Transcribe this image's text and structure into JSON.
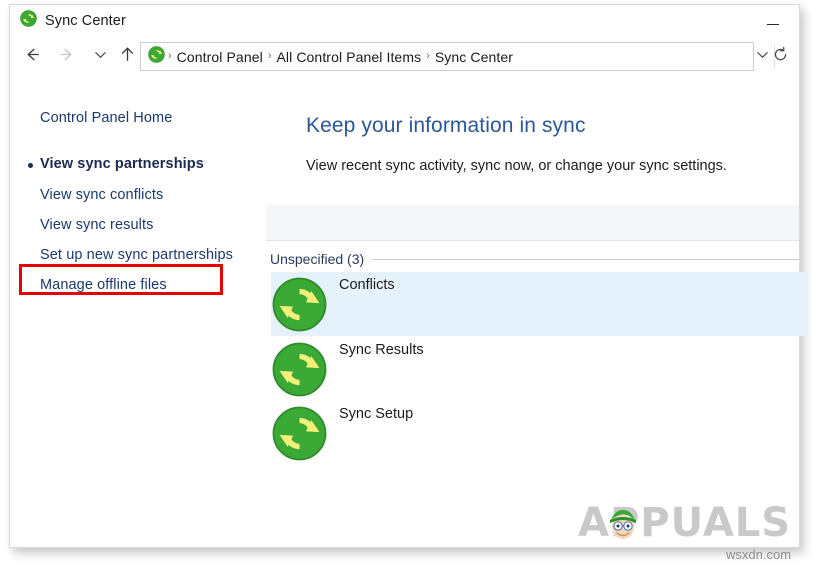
{
  "window": {
    "title": "Sync Center",
    "title_icon": "sync-icon",
    "minimize_label": "Minimize"
  },
  "nav": {
    "back_icon": "arrow-left-icon",
    "forward_icon": "arrow-right-icon",
    "recent_icon": "chevron-down-icon",
    "up_icon": "arrow-up-icon",
    "refresh_icon": "refresh-icon",
    "address_chevron_icon": "chevron-down-icon",
    "address_icon": "sync-icon",
    "breadcrumbs": [
      "Control Panel",
      "All Control Panel Items",
      "Sync Center"
    ],
    "separator": "›"
  },
  "sidebar": {
    "home_label": "Control Panel Home",
    "items": [
      {
        "label": "View sync partnerships",
        "current": true
      },
      {
        "label": "View sync conflicts",
        "current": false
      },
      {
        "label": "View sync results",
        "current": false
      },
      {
        "label": "Set up new sync partnerships",
        "current": false
      },
      {
        "label": "Manage offline files",
        "current": false,
        "highlighted": true
      }
    ]
  },
  "main": {
    "heading": "Keep your information in sync",
    "subheading": "View recent sync activity, sync now, or change your sync settings.",
    "group_label": "Unspecified (3)",
    "tiles": [
      {
        "label": "Conflicts",
        "icon": "sync-icon",
        "selected": true
      },
      {
        "label": "Sync Results",
        "icon": "sync-icon",
        "selected": false
      },
      {
        "label": "Sync Setup",
        "icon": "sync-icon",
        "selected": false
      }
    ]
  },
  "watermark": {
    "brand": "APPUALS",
    "mascot_icon": "appuals-mascot-icon",
    "site": "wsxdn.com"
  },
  "colors": {
    "accent_heading": "#2b5797",
    "link": "#1b3a6b",
    "selection": "#e5f1fb",
    "highlight_box": "#e60000",
    "sync_green": "#3aa935",
    "sync_arrow": "#f7e600"
  }
}
